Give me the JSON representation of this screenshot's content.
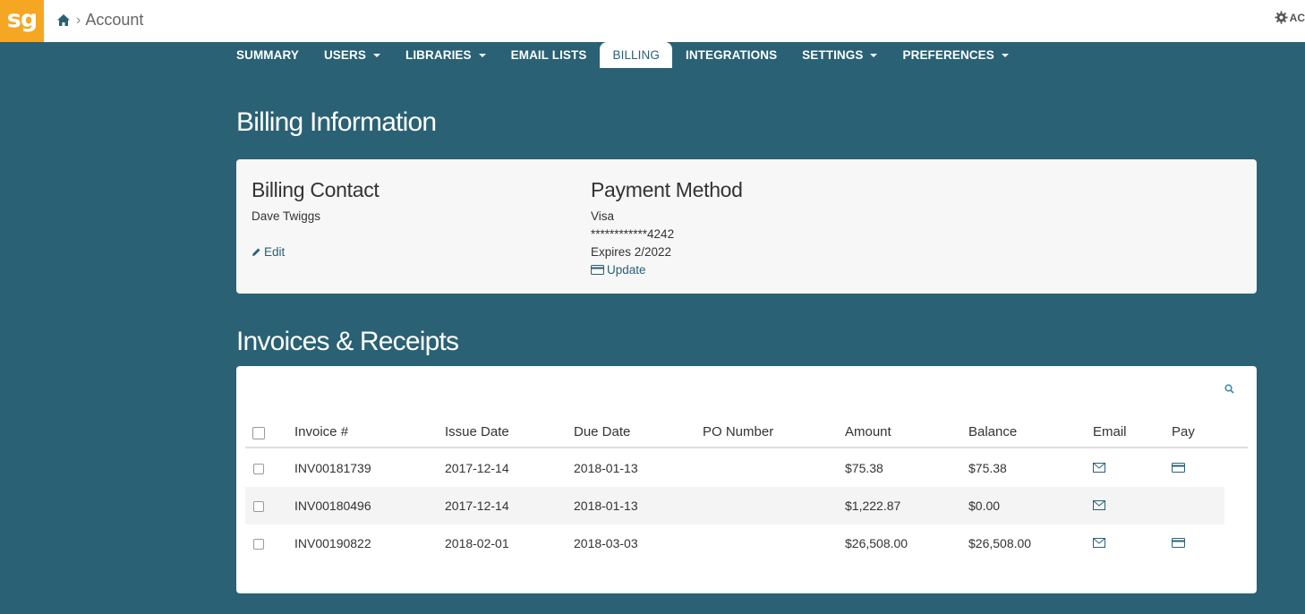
{
  "logo_text": "sg",
  "breadcrumb": {
    "home_icon": "home-icon",
    "separator": "›",
    "current": "Account"
  },
  "account_menu": {
    "icon": "gear-icon",
    "label": "AC"
  },
  "nav": {
    "tabs": [
      {
        "label": "SUMMARY",
        "dropdown": false,
        "active": false
      },
      {
        "label": "USERS",
        "dropdown": true,
        "active": false
      },
      {
        "label": "LIBRARIES",
        "dropdown": true,
        "active": false
      },
      {
        "label": "EMAIL LISTS",
        "dropdown": false,
        "active": false
      },
      {
        "label": "BILLING",
        "dropdown": false,
        "active": true
      },
      {
        "label": "INTEGRATIONS",
        "dropdown": false,
        "active": false
      },
      {
        "label": "SETTINGS",
        "dropdown": true,
        "active": false
      },
      {
        "label": "PREFERENCES",
        "dropdown": true,
        "active": false
      }
    ]
  },
  "billing": {
    "heading": "Billing Information",
    "contact": {
      "title": "Billing Contact",
      "name": "Dave Twiggs",
      "edit_label": "Edit"
    },
    "payment": {
      "title": "Payment Method",
      "card_type": "Visa",
      "card_number": "************4242",
      "expires": "Expires 2/2022",
      "update_label": "Update"
    }
  },
  "invoices": {
    "heading": "Invoices & Receipts",
    "search_icon": "search-icon",
    "columns": {
      "invoice": "Invoice #",
      "issue_date": "Issue Date",
      "due_date": "Due Date",
      "po_number": "PO Number",
      "amount": "Amount",
      "balance": "Balance",
      "email": "Email",
      "pay": "Pay"
    },
    "rows": [
      {
        "invoice": "INV00181739",
        "issue_date": "2017-12-14",
        "due_date": "2018-01-13",
        "po_number": "",
        "amount": "$75.38",
        "balance": "$75.38",
        "payable": true
      },
      {
        "invoice": "INV00180496",
        "issue_date": "2017-12-14",
        "due_date": "2018-01-13",
        "po_number": "",
        "amount": "$1,222.87",
        "balance": "$0.00",
        "payable": false
      },
      {
        "invoice": "INV00190822",
        "issue_date": "2018-02-01",
        "due_date": "2018-03-03",
        "po_number": "",
        "amount": "$26,508.00",
        "balance": "$26,508.00",
        "payable": true
      }
    ]
  },
  "colors": {
    "brand": "#f5a623",
    "primary": "#2a6174",
    "link": "#2a6174"
  }
}
